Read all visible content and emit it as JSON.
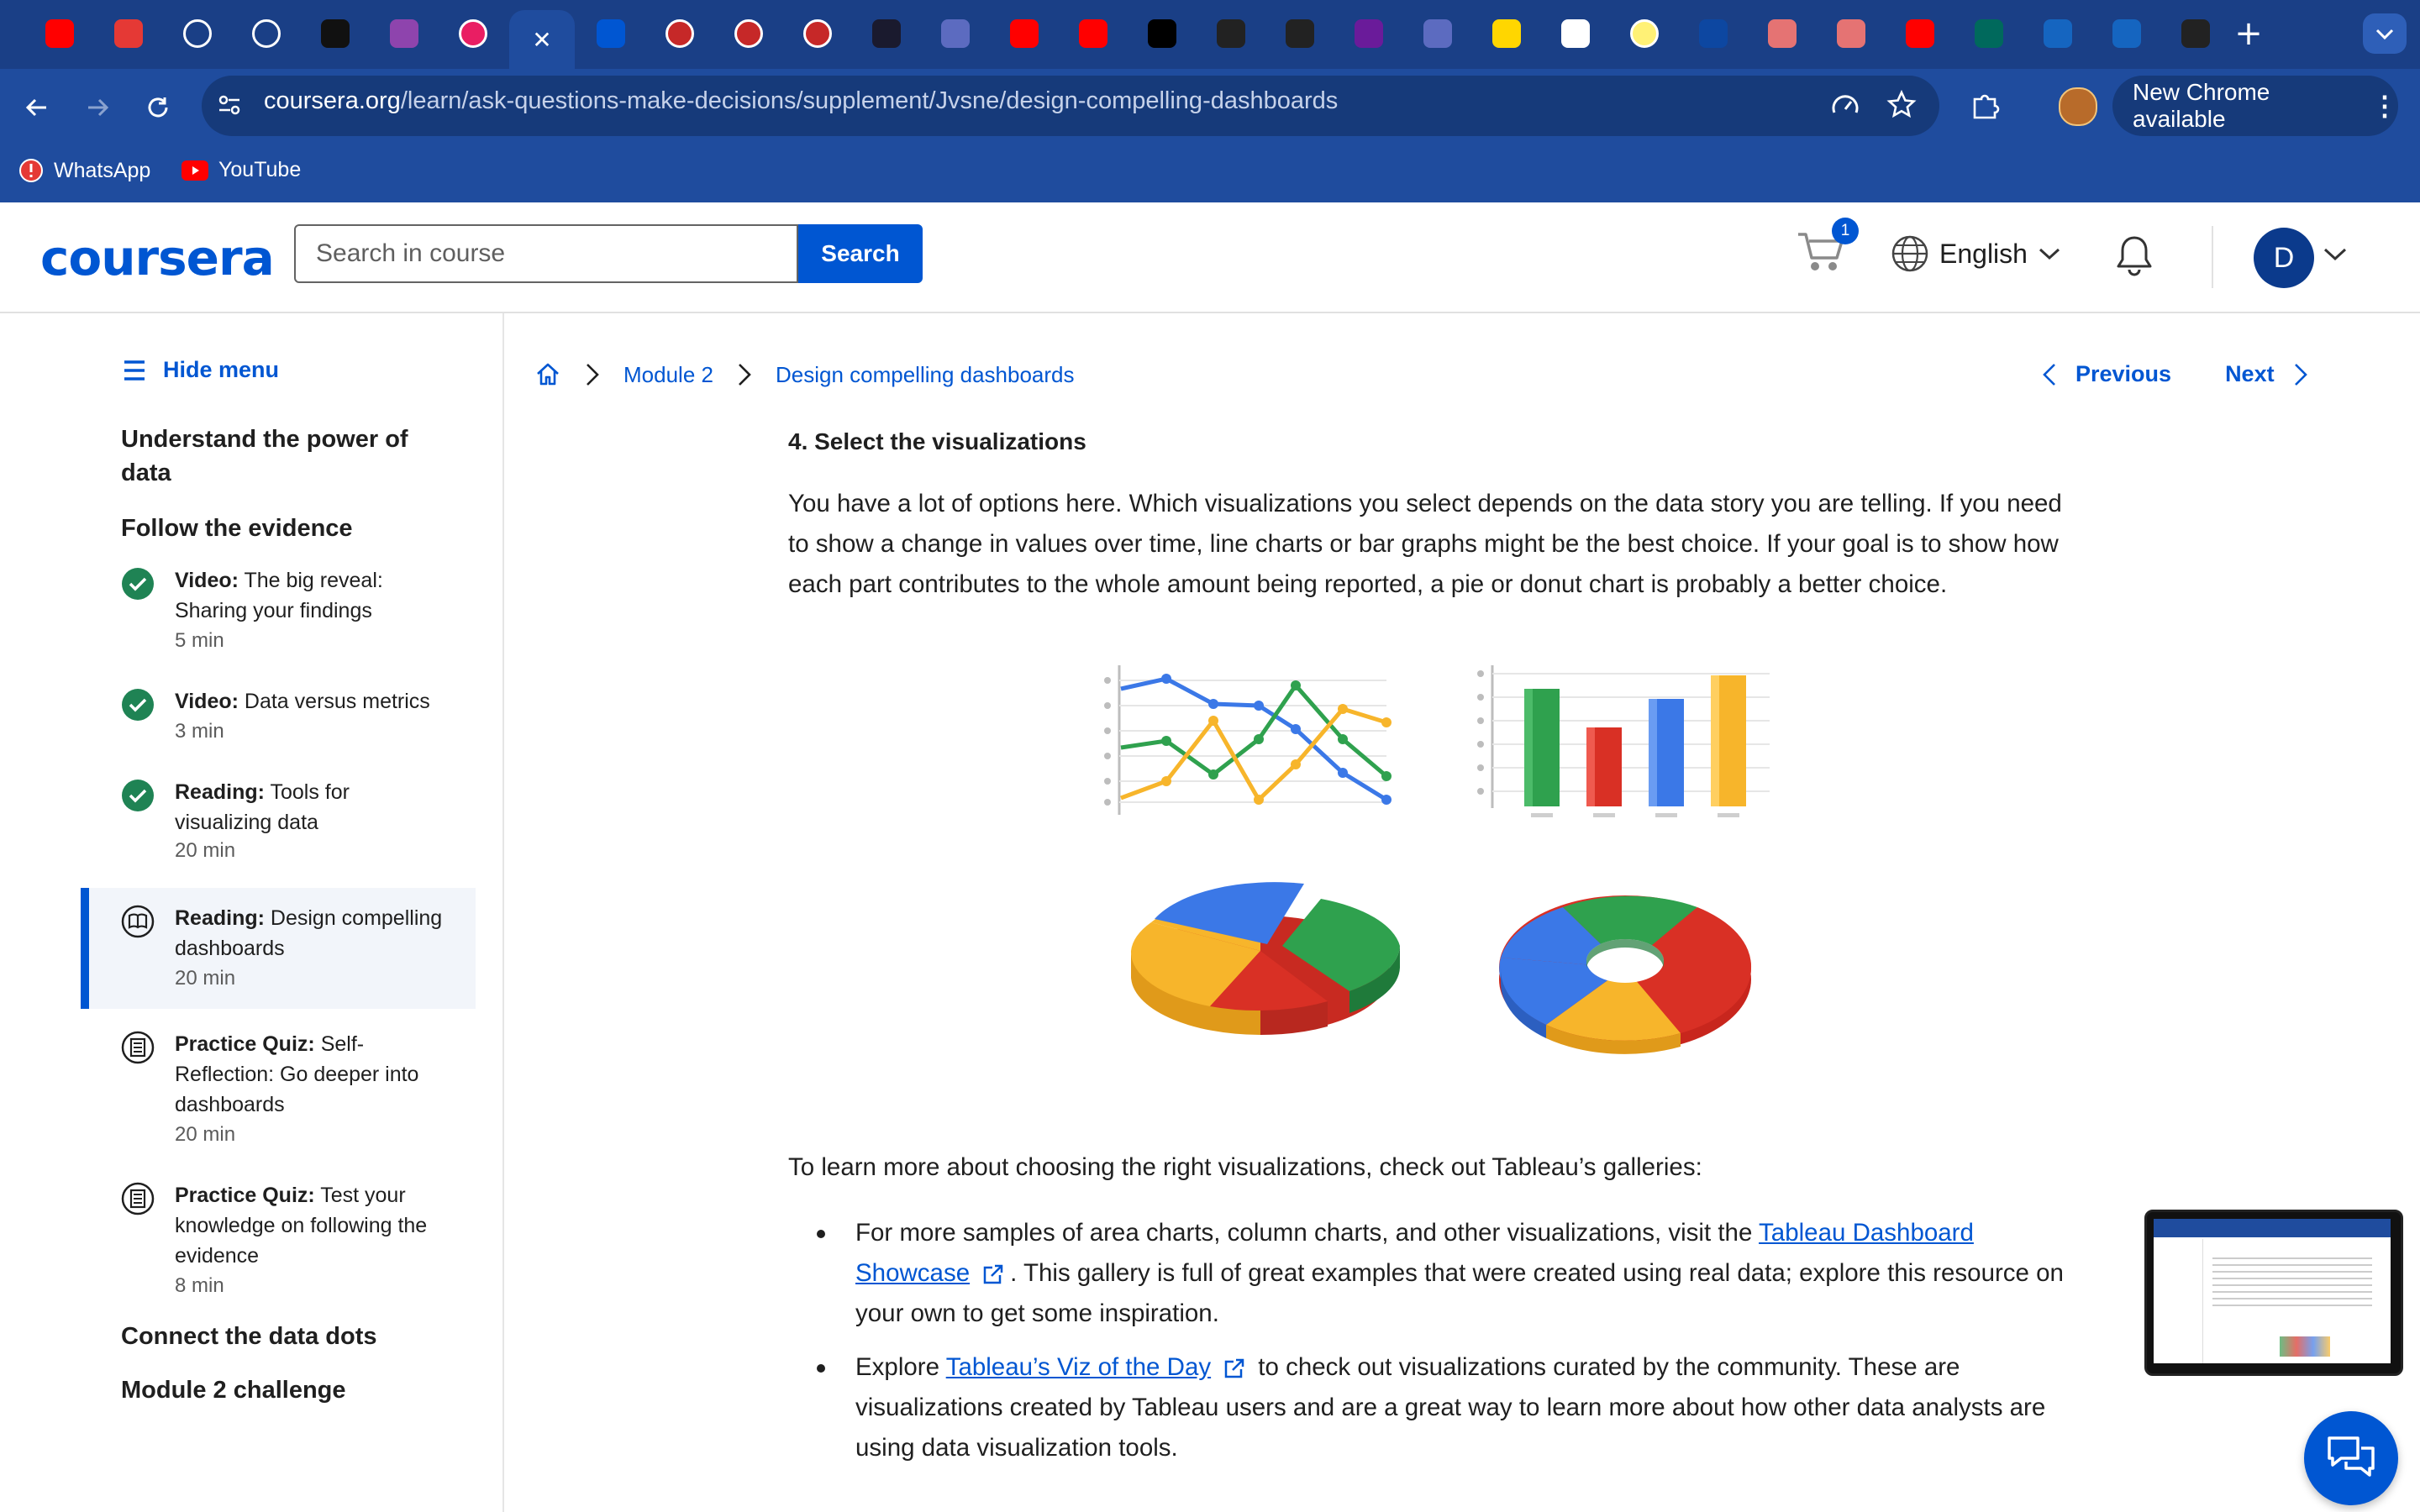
{
  "browser": {
    "url_host": "coursera.org",
    "url_path": "/learn/ask-questions-make-decisions/supplement/Jvsne/design-compelling-dashboards",
    "update_label": "New Chrome available",
    "bookmarks": [
      {
        "label": "WhatsApp",
        "icon": "alert-circle-icon"
      },
      {
        "label": "YouTube",
        "icon": "youtube-icon"
      }
    ],
    "tab_icons": [
      "youtube",
      "alert",
      "circle",
      "circle",
      "github",
      "bookmark",
      "ring",
      "close-active",
      "coursera",
      "youtube-ring",
      "youtube-ring",
      "youtube-ring",
      "dark",
      "m-logo",
      "youtube",
      "youtube",
      "dark-text",
      "openai",
      "openai",
      "camera",
      "m-logo",
      "b-yellow",
      "google",
      "ring-yellow",
      "wave",
      "red-ball",
      "red-ball",
      "youtube",
      "my-unt",
      "c-blue",
      "c-blue",
      "openai"
    ],
    "active_tab_glyph": "✕"
  },
  "header": {
    "logo": "coursera",
    "search_placeholder": "Search in course",
    "search_button": "Search",
    "cart_count": "1",
    "language": "English",
    "avatar_initial": "D"
  },
  "sidebar": {
    "hide_menu": "Hide menu",
    "section1": "Understand the power of data",
    "section2": "Follow the evidence",
    "items": [
      {
        "type": "Video:",
        "title": "The big reveal: Sharing your findings",
        "duration": "5 min",
        "status": "completed"
      },
      {
        "type": "Video:",
        "title": "Data versus metrics",
        "duration": "3 min",
        "status": "completed"
      },
      {
        "type": "Reading:",
        "title": "Tools for visualizing data",
        "duration": "20 min",
        "status": "completed"
      },
      {
        "type": "Reading:",
        "title": "Design compelling dashboards",
        "duration": "20 min",
        "status": "current"
      },
      {
        "type": "Practice Quiz:",
        "title": "Self-Reflection: Go deeper into dashboards",
        "duration": "20 min",
        "status": "pending"
      },
      {
        "type": "Practice Quiz:",
        "title": "Test your knowledge on following the evidence",
        "duration": "8 min",
        "status": "pending"
      }
    ],
    "section3": "Connect the data dots",
    "section4": "Module 2 challenge"
  },
  "breadcrumb": {
    "module": "Module 2",
    "page": "Design compelling dashboards"
  },
  "nav": {
    "previous": "Previous",
    "next": "Next"
  },
  "content": {
    "heading": "4. Select the visualizations",
    "para1": "You have a lot of options here. Which visualizations you select depends on the data story you are telling. If you need to show a change in values over time, line charts or bar graphs might be the best choice. If your goal is to show how each part contributes to the whole amount being reported, a pie or donut chart is probably a better choice.",
    "para2": "To learn more about choosing the right visualizations, check out Tableau’s galleries:",
    "bullet1_pre": "For more samples of area charts, column charts, and other visualizations, visit the ",
    "bullet1_link": "Tableau Dashboard Showcase",
    "bullet1_post": ". This gallery is full of great examples that were created using real data; explore this resource on your own to get some inspiration.",
    "bullet2_pre": "Explore ",
    "bullet2_link": "Tableau’s Viz of the Day",
    "bullet2_post": " to check out visualizations curated by the community. These are visualizations created by Tableau users and are a great way to learn more about how other data analysts are using data visualization tools."
  },
  "colors": {
    "chrome_bg": "#1f4c9e",
    "brand": "#0056d2",
    "complete": "#1f8354",
    "viz_blue": "#3b78e7",
    "viz_red": "#d93025",
    "viz_green": "#2fa14e",
    "viz_yellow": "#f7b52b"
  }
}
